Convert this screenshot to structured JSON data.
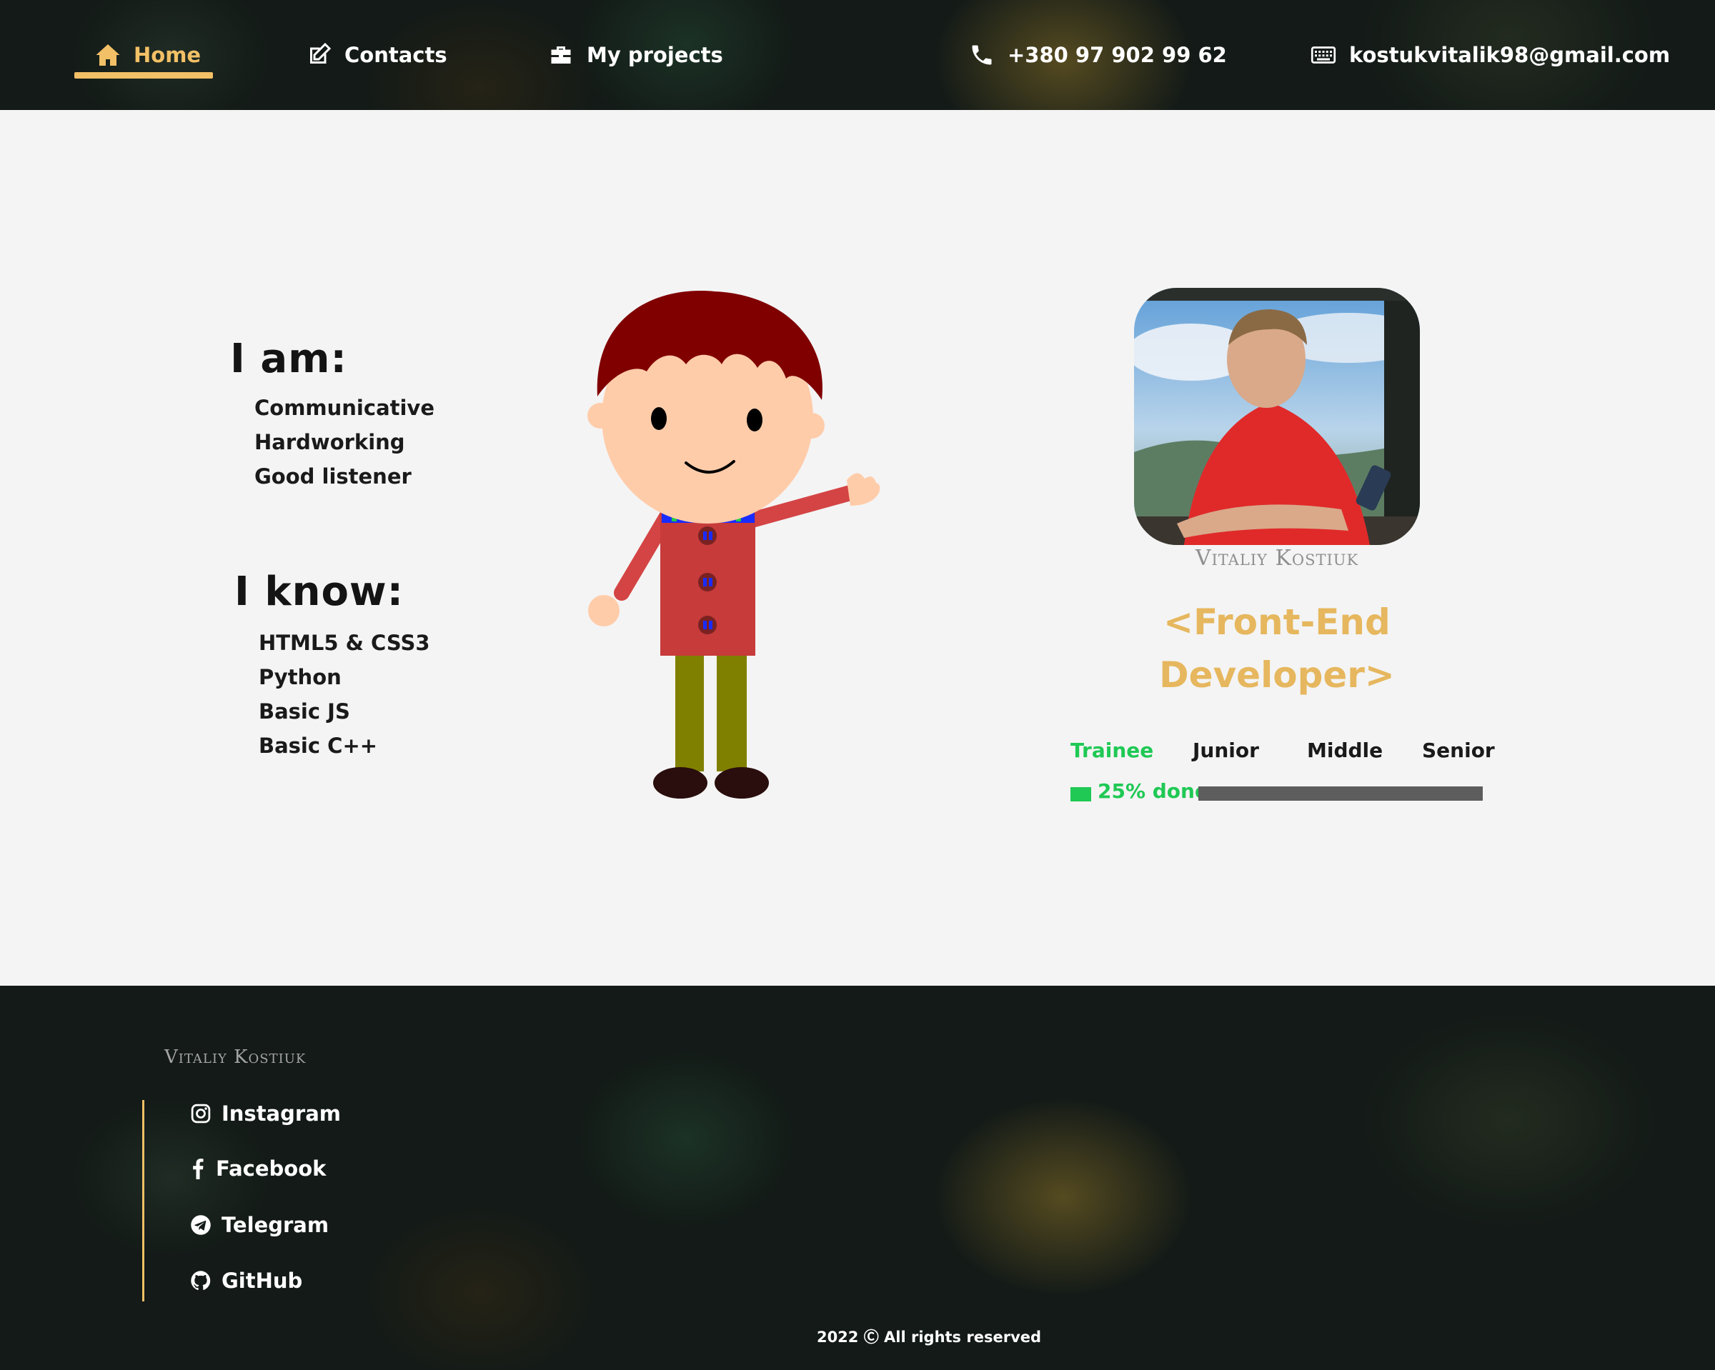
{
  "nav": {
    "home": "Home",
    "contacts": "Contacts",
    "projects": "My projects",
    "phone": "+380 97 902 99 62",
    "email": "kostukvitalik98@gmail.com"
  },
  "about": {
    "title": "I am:",
    "items": [
      "Communicative",
      "Hardworking",
      "Good listener"
    ]
  },
  "skills": {
    "title": "I know:",
    "items": [
      "HTML5 & CSS3",
      "Python",
      "Basic JS",
      "Basic C++"
    ]
  },
  "profile": {
    "name": "Vitaliy Kostiuk",
    "role_line1": "<Front-End",
    "role_line2": "Developer>"
  },
  "progress": {
    "levels": [
      "Trainee",
      "Junior",
      "Middle",
      "Senior"
    ],
    "current": "Trainee",
    "percent": 25,
    "label": "25% done"
  },
  "footer": {
    "name": "Vitaliy Kostiuk",
    "links": [
      "Instagram",
      "Facebook",
      "Telegram",
      "GitHub"
    ],
    "copyright": "2022 Ⓒ All rights reserved"
  },
  "colors": {
    "accent": "#f2c066",
    "role": "#e6b75e",
    "progress": "#1fc954",
    "track": "#5d5d5d"
  }
}
